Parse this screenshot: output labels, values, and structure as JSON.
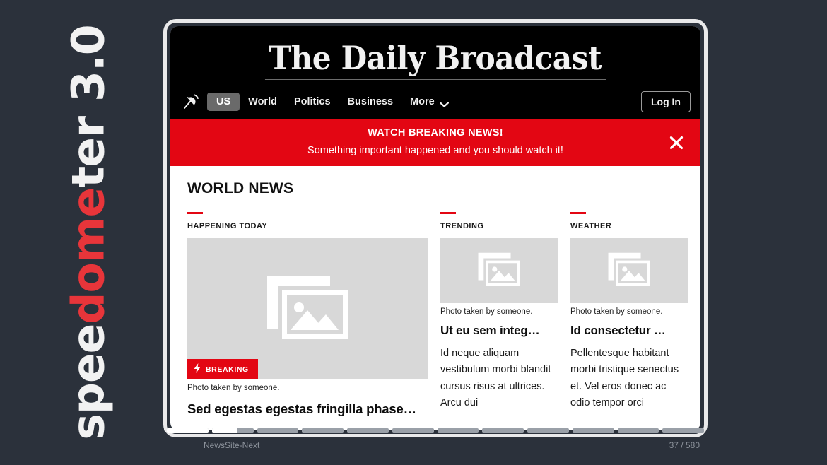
{
  "brand": {
    "prefix": "spee",
    "accent": "dome",
    "suffix": "ter 3.0",
    "full": "speedometer 3.0",
    "accent_color": "#e8353a",
    "text_color": "#f2f2f2"
  },
  "site": {
    "masthead": "The Daily Broadcast",
    "nav_icon": "satellite-dish-icon",
    "nav_items": [
      {
        "label": "US",
        "active": true
      },
      {
        "label": "World",
        "active": false
      },
      {
        "label": "Politics",
        "active": false
      },
      {
        "label": "Business",
        "active": false
      },
      {
        "label": "More",
        "active": false,
        "icon": "chevron-down-icon"
      }
    ],
    "login_label": "Log In"
  },
  "banner": {
    "title": "WATCH BREAKING NEWS!",
    "subtitle": "Something important happened and you should watch it!",
    "close_icon": "close-icon",
    "color": "#e30613"
  },
  "content": {
    "section_title": "WORLD NEWS",
    "columns": [
      {
        "kicker": "HAPPENING TODAY",
        "image_icon": "image-placeholder-icon",
        "badge": {
          "label": "BREAKING",
          "icon": "bolt-icon"
        },
        "caption": "Photo taken by someone.",
        "headline": "Sed egestas egestas fringilla phase…",
        "dek": ""
      },
      {
        "kicker": "TRENDING",
        "image_icon": "image-placeholder-icon",
        "caption": "Photo taken by someone.",
        "headline": "Ut eu sem integ…",
        "dek": "Id neque aliquam vestibulum morbi blandit cursus risus at ultrices. Arcu dui"
      },
      {
        "kicker": "WEATHER",
        "image_icon": "image-placeholder-icon",
        "caption": "Photo taken by someone.",
        "headline": "Id consectetur …",
        "dek": "Pellentesque habitant morbi tristique senectus et. Vel eros donec ac odio tempor orci"
      }
    ]
  },
  "statusbar": {
    "test_name": "NewsSite-Next",
    "counter": "37 / 580",
    "segments": [
      100,
      62,
      0,
      0,
      0,
      0,
      0,
      0,
      0,
      0,
      0,
      0
    ]
  }
}
